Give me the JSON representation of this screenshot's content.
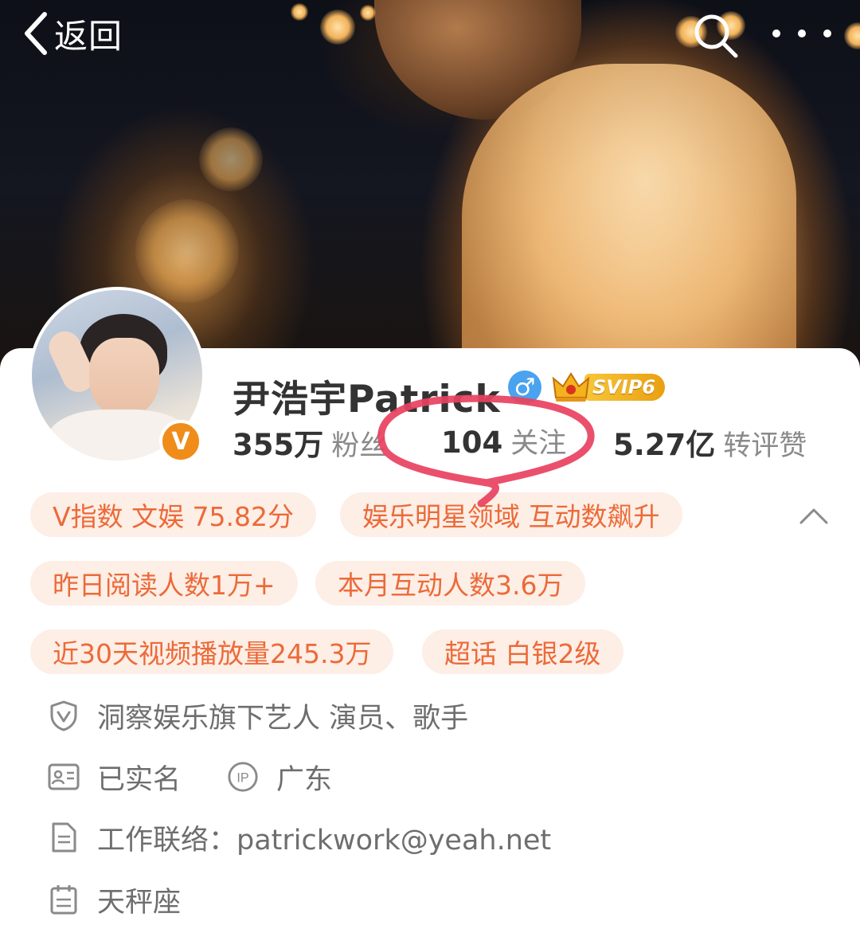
{
  "topbar": {
    "back_label": "返回",
    "back_icon": "chevron-left-icon",
    "search_icon": "search-icon",
    "more_icon": "more-dots-icon"
  },
  "profile": {
    "username": "尹浩宇Patrick",
    "gender_icon": "male-icon",
    "gender_symbol": "♂",
    "verified_badge": "V",
    "svip_label": "SVIP6",
    "stats": {
      "fans_value": "355万",
      "fans_label": "粉丝",
      "follow_value": "104",
      "follow_label": "关注",
      "likes_value": "5.27亿",
      "likes_label": "转评赞"
    }
  },
  "tags": {
    "row1": [
      "V指数 文娱 75.82分",
      "娱乐明星领域 互动数飙升"
    ],
    "row2": [
      "昨日阅读人数1万+",
      "本月互动人数3.6万"
    ],
    "row3": [
      "近30天视频播放量245.3万",
      "超话 白银2级"
    ]
  },
  "info": {
    "agency": "洞察娱乐旗下艺人 演员、歌手",
    "realname": "已实名",
    "ip_badge": "IP",
    "ip_location": "广东",
    "contact": "工作联络：patrickwork@yeah.net",
    "zodiac": "天秤座"
  },
  "colors": {
    "tag_bg": "#fdeee6",
    "tag_text": "#ec6a38",
    "verified_orange": "#f08c1a",
    "gender_blue": "#4aa3ef",
    "annotation_red": "#e8415f"
  }
}
